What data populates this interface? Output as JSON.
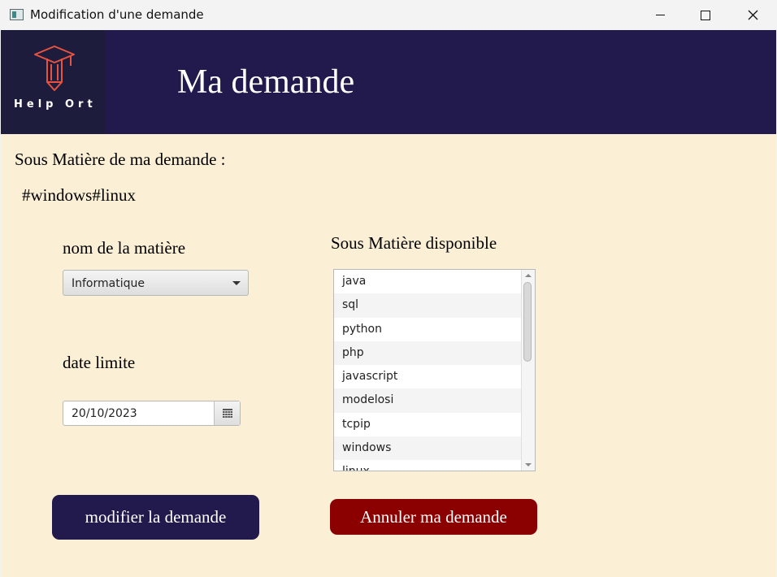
{
  "window": {
    "title": "Modification d'une demande"
  },
  "header": {
    "logo_text": "Help Ort",
    "title": "Ma demande"
  },
  "form": {
    "sous_matiere_label": "Sous Matière de ma demande :",
    "sous_matiere_value": "#windows#linux",
    "matiere_label": "nom de la matière",
    "matiere_selected": "Informatique",
    "date_label": "date limite",
    "date_value": "20/10/2023",
    "dispo_label": "Sous Matière disponible",
    "dispo_items": [
      "java",
      "sql",
      "python",
      "php",
      "javascript",
      "modelosi",
      "tcpip",
      "windows",
      "linux"
    ]
  },
  "buttons": {
    "modify": "modifier la demande",
    "cancel": "Annuler ma demande"
  },
  "colors": {
    "header_bg": "#22194c",
    "logo_accent": "#e8533f",
    "page_bg": "#fbefd5",
    "cancel_bg": "#8b0000"
  },
  "icons": [
    "app-icon",
    "minimize-icon",
    "maximize-icon",
    "close-icon",
    "graduation-pencil-logo",
    "chevron-down-icon",
    "calendar-icon"
  ]
}
